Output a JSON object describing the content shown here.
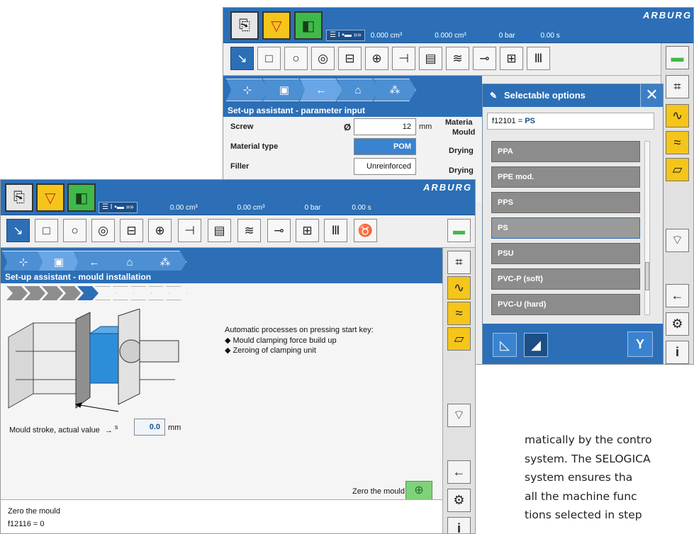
{
  "brand": "ARBURG",
  "back": {
    "status": [
      "0.000 cm³",
      "0.000 cm³",
      "0 bar",
      "0.00 s"
    ],
    "panel_title": "Set-up assistant - parameter input",
    "params": [
      {
        "label": "Screw",
        "symbol": "Ø",
        "value": "12",
        "unit": "mm"
      },
      {
        "label": "Material type",
        "value": "POM"
      },
      {
        "label": "Filler",
        "value": "Unreinforced"
      }
    ],
    "right_labels": [
      "Materia",
      "Mould",
      "Drying",
      "Drying"
    ]
  },
  "dialog": {
    "title": "Selectable options",
    "close": "✕",
    "input_prefix": "f12101 =",
    "input_value": "PS",
    "options": [
      "PPA",
      "PPE mod.",
      "PPS",
      "PS",
      "PSU",
      "PVC-P (soft)",
      "PVC-U (hard)"
    ],
    "selected": "PS",
    "confirm": "Y"
  },
  "front": {
    "status": [
      "0.00 cm³",
      "0.00 cm³",
      "0 bar",
      "0.00 s"
    ],
    "panel_title": "Set-up assistant - mould installation",
    "progress": {
      "total": 10,
      "done": 4,
      "current": 5
    },
    "auto_heading": "Automatic processes on pressing start key:",
    "auto_items": [
      "Mould clamping force build up",
      "Zeroing of clamping unit"
    ],
    "stroke_label": "Mould stroke, actual value",
    "stroke_symbol": "s",
    "stroke_value": "0.0",
    "stroke_unit": "mm",
    "zero_label": "Zero the mould",
    "footer_title": "Zero the mould",
    "footer_code": "f12116 = 0"
  },
  "paragraph": [
    "matically by the contro",
    "system. The SELOGICA",
    "system ensures tha",
    "all the machine func",
    "tions selected in step"
  ],
  "colors": {
    "accent": "#2c6fb6",
    "warning": "#f5c51a",
    "ok": "#3fb94a"
  }
}
